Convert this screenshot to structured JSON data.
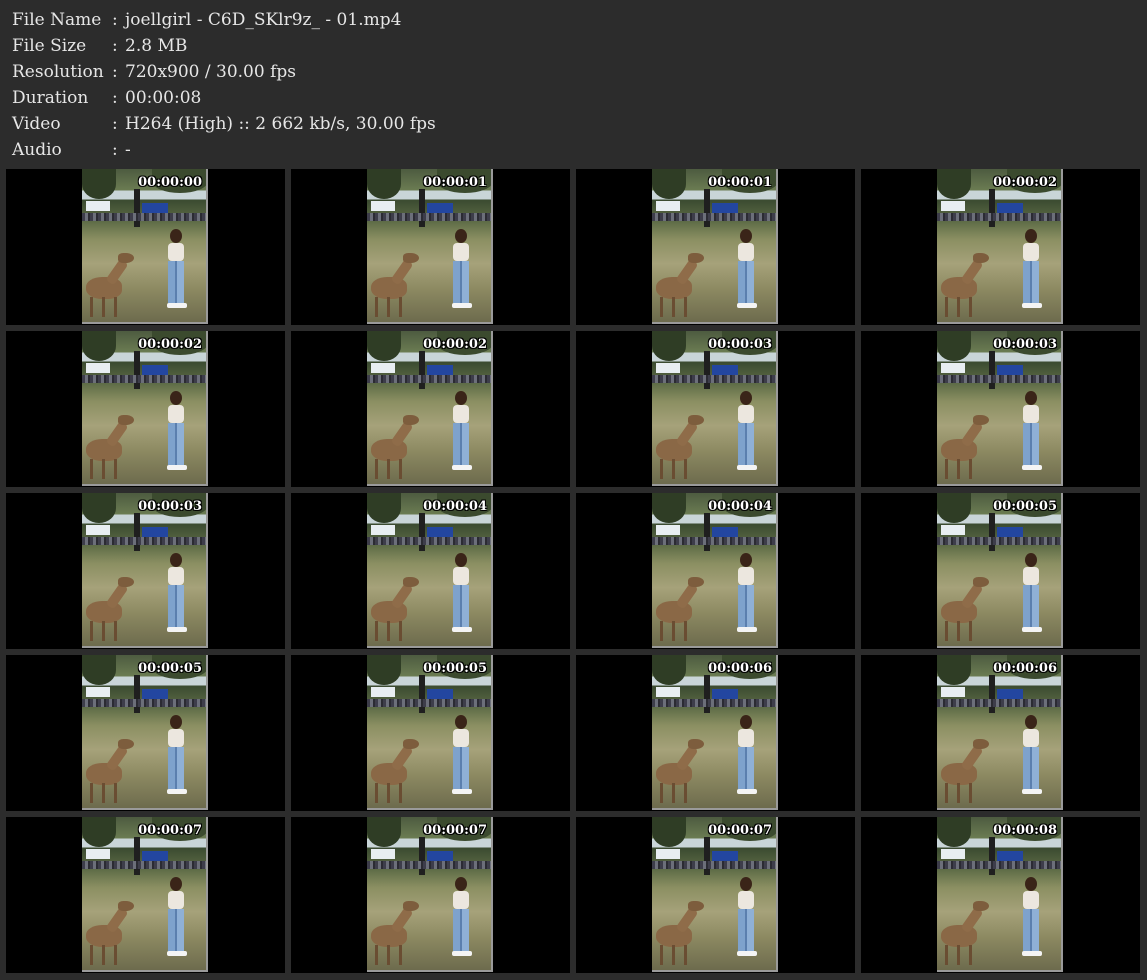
{
  "info": {
    "file_name_label": "File Name",
    "file_name": "joellgirl - C6D_SKlr9z_ - 01.mp4",
    "file_size_label": "File Size",
    "file_size": "2.8 MB",
    "resolution_label": "Resolution",
    "resolution": "720x900 / 30.00 fps",
    "duration_label": "Duration",
    "duration": "00:00:08",
    "video_label": "Video",
    "video": "H264 (High) :: 2 662 kb/s, 30.00 fps",
    "audio_label": "Audio",
    "audio": "-",
    "separator": ":"
  },
  "thumbnails": [
    {
      "timestamp": "00:00:00"
    },
    {
      "timestamp": "00:00:01"
    },
    {
      "timestamp": "00:00:01"
    },
    {
      "timestamp": "00:00:02"
    },
    {
      "timestamp": "00:00:02"
    },
    {
      "timestamp": "00:00:02"
    },
    {
      "timestamp": "00:00:03"
    },
    {
      "timestamp": "00:00:03"
    },
    {
      "timestamp": "00:00:03"
    },
    {
      "timestamp": "00:00:04"
    },
    {
      "timestamp": "00:00:04"
    },
    {
      "timestamp": "00:00:05"
    },
    {
      "timestamp": "00:00:05"
    },
    {
      "timestamp": "00:00:05"
    },
    {
      "timestamp": "00:00:06"
    },
    {
      "timestamp": "00:00:06"
    },
    {
      "timestamp": "00:00:07"
    },
    {
      "timestamp": "00:00:07"
    },
    {
      "timestamp": "00:00:07"
    },
    {
      "timestamp": "00:00:08"
    }
  ]
}
